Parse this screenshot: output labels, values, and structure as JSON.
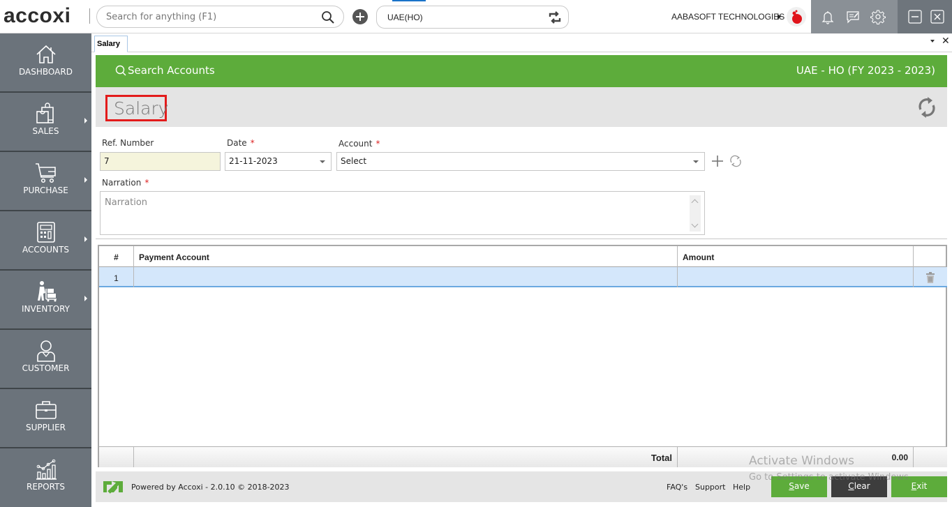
{
  "app": {
    "logo": "accoxi",
    "search_placeholder": "Search for anything (F1)",
    "branch": "UAE(HO)",
    "company": "AABASOFT TECHNOLOGIES"
  },
  "sidebar": {
    "items": [
      {
        "label": "DASHBOARD",
        "icon": "home-icon",
        "has_submenu": false
      },
      {
        "label": "SALES",
        "icon": "shopping-bags-icon",
        "has_submenu": true
      },
      {
        "label": "PURCHASE",
        "icon": "cart-icon",
        "has_submenu": true
      },
      {
        "label": "ACCOUNTS",
        "icon": "calculator-icon",
        "has_submenu": true
      },
      {
        "label": "INVENTORY",
        "icon": "dolly-worker-icon",
        "has_submenu": true
      },
      {
        "label": "CUSTOMER",
        "icon": "user-icon",
        "has_submenu": false
      },
      {
        "label": "SUPPLIER",
        "icon": "briefcase-icon",
        "has_submenu": false
      },
      {
        "label": "REPORTS",
        "icon": "chart-icon",
        "has_submenu": false
      }
    ]
  },
  "tabs": [
    {
      "label": "Salary",
      "active": true
    }
  ],
  "header": {
    "search_accounts": "Search Accounts",
    "fiscal": "UAE - HO (FY 2023 - 2023)",
    "page_title": "Salary"
  },
  "form": {
    "ref_label": "Ref. Number",
    "ref_value": "7",
    "date_label": "Date",
    "date_value": "21-11-2023",
    "account_label": "Account",
    "account_value": "Select",
    "narration_label": "Narration",
    "narration_placeholder": "Narration",
    "required_mark": "*"
  },
  "grid": {
    "columns": [
      "#",
      "Payment Account",
      "Amount",
      ""
    ],
    "rows": [
      {
        "index": "1",
        "payment_account": "",
        "amount": ""
      }
    ],
    "total_label": "Total",
    "total_value": "0.00"
  },
  "footer": {
    "powered": "Powered by Accoxi - 2.0.10 © 2018-2023",
    "links": [
      "FAQ's",
      "Support",
      "Help"
    ],
    "save": {
      "u": "S",
      "rest": "ave"
    },
    "clear": {
      "u": "C",
      "rest": "lear"
    },
    "exit": {
      "u": "E",
      "rest": "xit"
    }
  },
  "watermark": {
    "line1": "Activate Windows",
    "line2": "Go to Settings to activate Windows."
  },
  "colors": {
    "accent_green": "#5dac3b",
    "sidebar": "#6b737b",
    "title_highlight": "#e31b1b",
    "row_selected": "#d4e7fb"
  }
}
